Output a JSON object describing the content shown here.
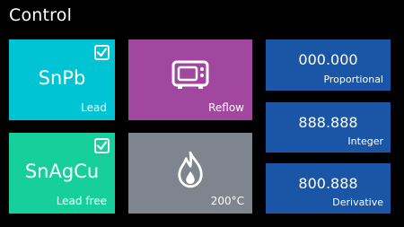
{
  "header": {
    "title": "Control"
  },
  "tiles": {
    "lead": {
      "alloy": "SnPb",
      "caption": "Lead",
      "checked": true,
      "color": "#00c4d4"
    },
    "lead_free": {
      "alloy": "SnAgCu",
      "caption": "Lead free",
      "checked": true,
      "color": "#17cf9a"
    },
    "reflow": {
      "caption": "Reflow",
      "icon": "oven-icon",
      "color": "#a2479f"
    },
    "temperature": {
      "caption": "200°C",
      "icon": "flame-icon",
      "color": "#7e858e"
    }
  },
  "pid": {
    "color": "#1a55a6",
    "proportional": {
      "value": "000.000",
      "label": "Proportional"
    },
    "integer": {
      "value": "888.888",
      "label": "Integer"
    },
    "derivative": {
      "value": "800.888",
      "label": "Derivative"
    }
  }
}
